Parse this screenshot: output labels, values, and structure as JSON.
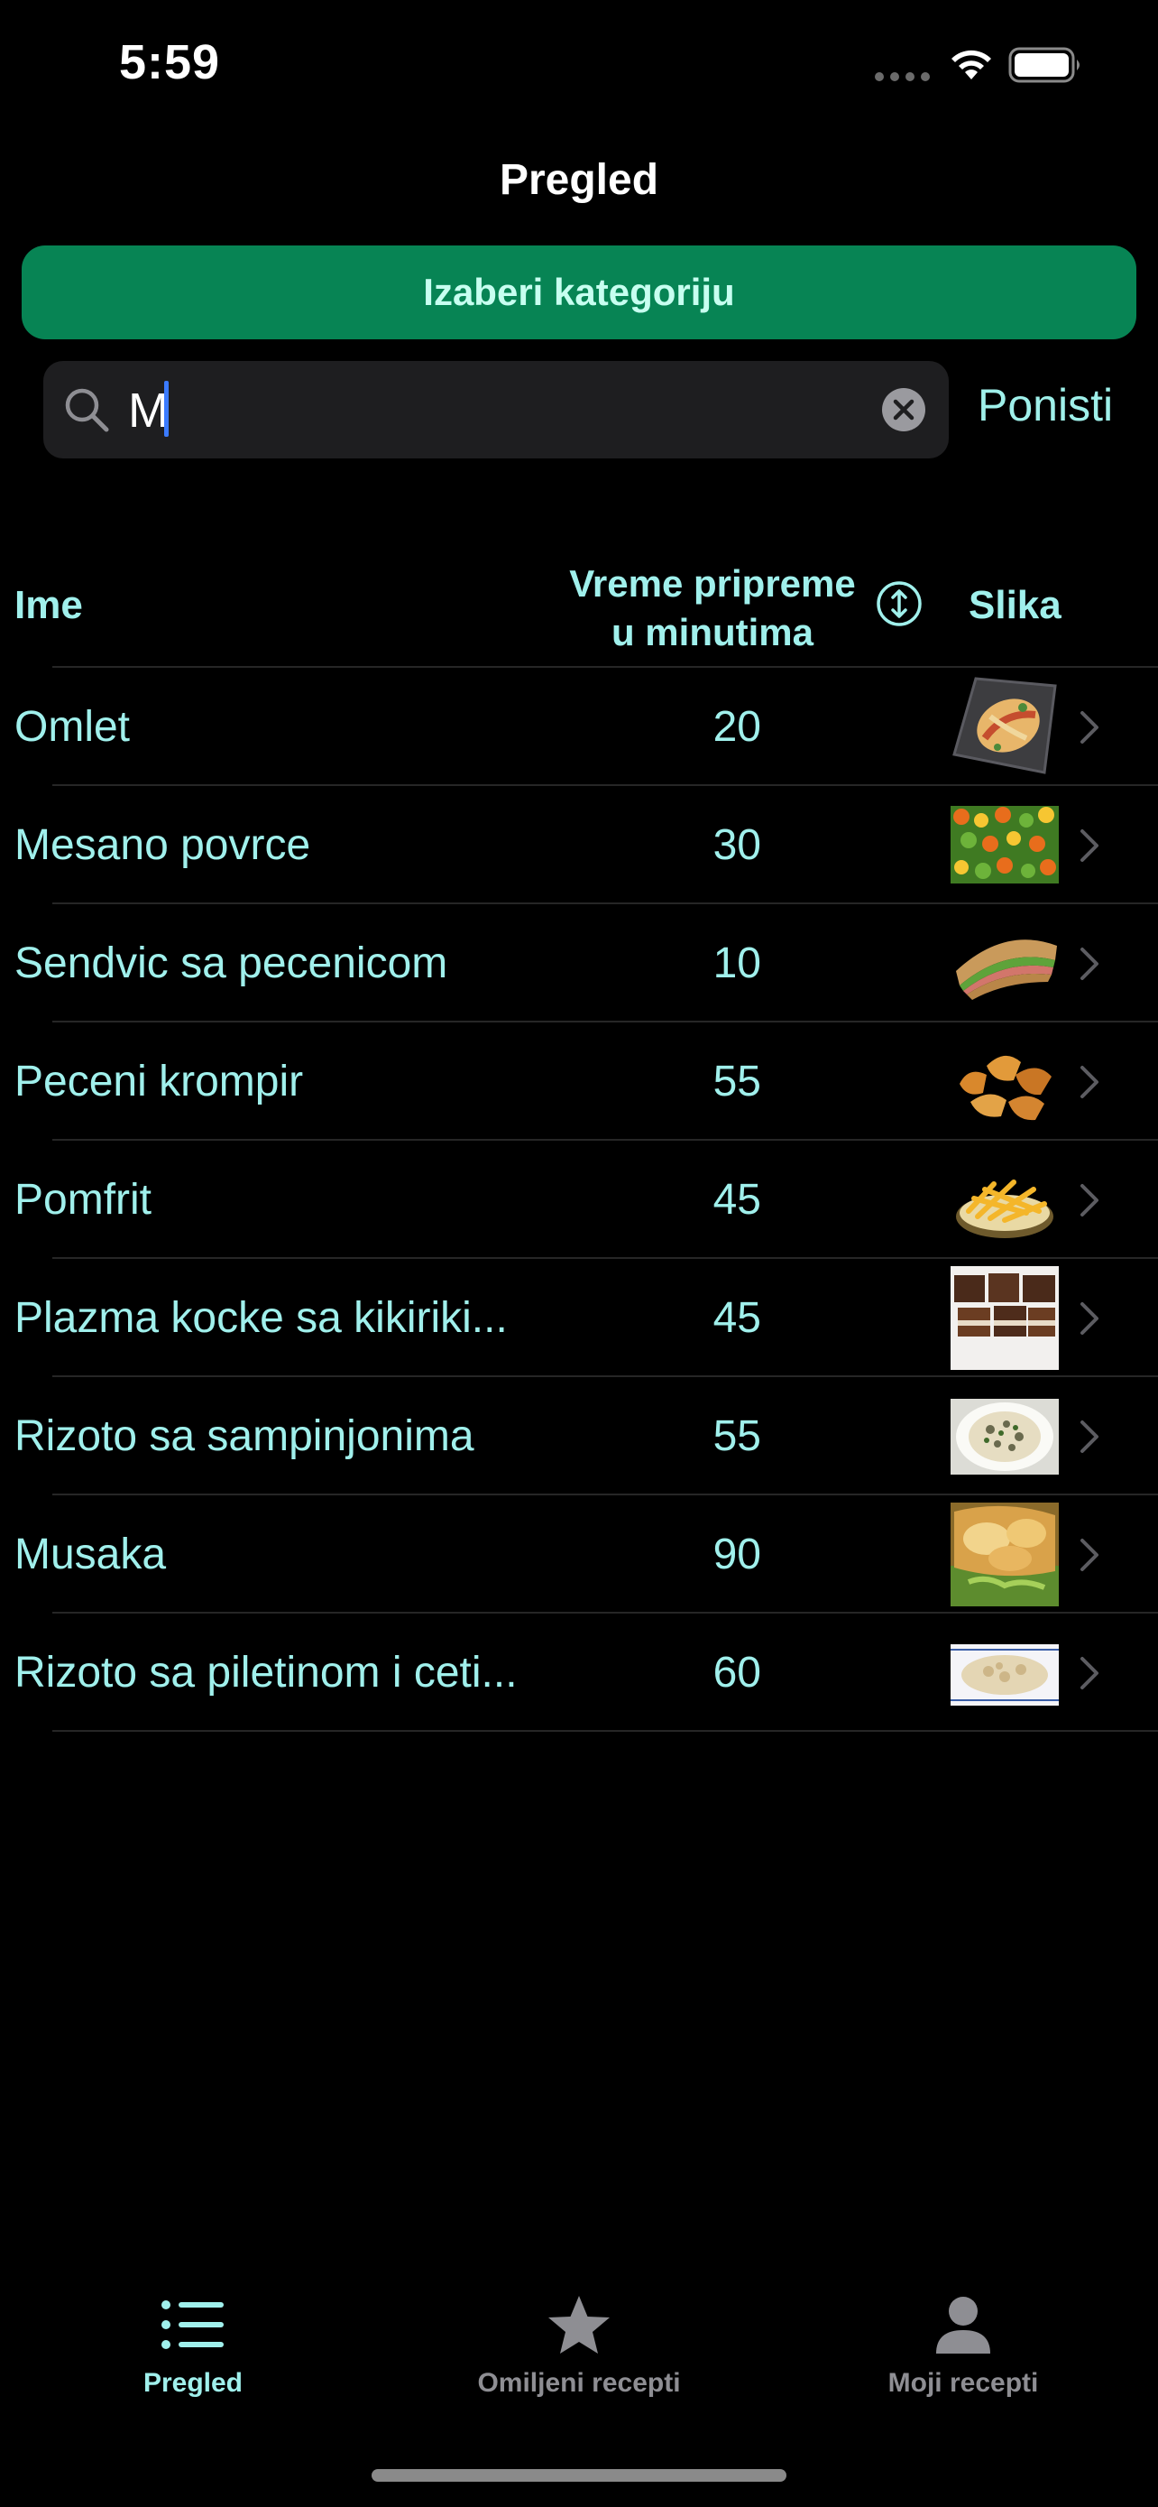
{
  "status_bar": {
    "time": "5:59"
  },
  "nav": {
    "title": "Pregled"
  },
  "category_button": {
    "label": "Izaberi kategoriju"
  },
  "search": {
    "value": "M",
    "cancel_label": "Ponisti"
  },
  "table": {
    "headers": {
      "name": "Ime",
      "time_line1": "Vreme pripreme",
      "time_line2": "u minutima",
      "image": "Slika"
    },
    "rows": [
      {
        "name": "Omlet",
        "time": "20",
        "thumb": "omelette-image"
      },
      {
        "name": "Mesano povrce",
        "time": "30",
        "thumb": "mixed-vegetables-image"
      },
      {
        "name": "Sendvic sa pecenicom",
        "time": "10",
        "thumb": "sandwich-image"
      },
      {
        "name": "Peceni krompir",
        "time": "55",
        "thumb": "baked-potatoes-image"
      },
      {
        "name": "Pomfrit",
        "time": "45",
        "thumb": "fries-image"
      },
      {
        "name": "Plazma kocke sa kikiriki...",
        "time": "45",
        "thumb": "cake-cubes-image"
      },
      {
        "name": "Rizoto sa sampinjonima",
        "time": "55",
        "thumb": "mushroom-risotto-image"
      },
      {
        "name": "Musaka",
        "time": "90",
        "thumb": "moussaka-image"
      },
      {
        "name": "Rizoto sa piletinom i ceti...",
        "time": "60",
        "thumb": "chicken-risotto-image"
      }
    ]
  },
  "tabs": [
    {
      "label": "Pregled",
      "icon": "list-icon",
      "active": true
    },
    {
      "label": "Omiljeni recepti",
      "icon": "star-icon",
      "active": false
    },
    {
      "label": "Moji recepti",
      "icon": "person-icon",
      "active": false
    }
  ],
  "colors": {
    "accent": "#a0f0ec",
    "button_bg": "#078454",
    "button_text": "#c7fff0",
    "background": "#000000",
    "inactive_tab": "#8e8e93"
  }
}
